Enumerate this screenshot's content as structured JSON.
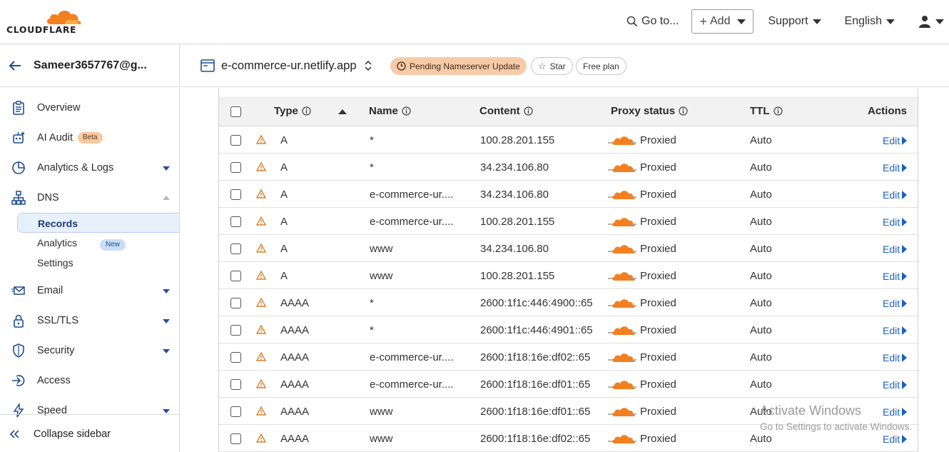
{
  "brand": {
    "logo_text": "CLOUDFLARE",
    "accent": "#f38020"
  },
  "topbar": {
    "goto_label": "Go to...",
    "add_label": "Add",
    "support_label": "Support",
    "language_label": "English"
  },
  "sidebar": {
    "account_name": "Sameer3657767@g...",
    "items": [
      {
        "label": "Overview",
        "icon": "clipboard-icon"
      },
      {
        "label": "AI Audit",
        "icon": "robot-icon",
        "badge": "Beta"
      },
      {
        "label": "Analytics & Logs",
        "icon": "pie-chart-icon"
      },
      {
        "label": "DNS",
        "icon": "network-icon"
      },
      {
        "label": "Email",
        "icon": "mail-icon"
      },
      {
        "label": "SSL/TLS",
        "icon": "lock-icon"
      },
      {
        "label": "Security",
        "icon": "shield-icon"
      },
      {
        "label": "Access",
        "icon": "access-icon"
      },
      {
        "label": "Speed",
        "icon": "bolt-icon"
      }
    ],
    "dns_sub": [
      {
        "label": "Records"
      },
      {
        "label": "Analytics",
        "badge": "New"
      },
      {
        "label": "Settings"
      }
    ],
    "collapse_label": "Collapse sidebar"
  },
  "zone": {
    "name": "e-commerce-ur.netlify.app",
    "status_pill": "Pending Nameserver Update",
    "star_label": "Star",
    "plan_label": "Free plan"
  },
  "table": {
    "headers": {
      "type": "Type",
      "name": "Name",
      "content": "Content",
      "proxy": "Proxy status",
      "ttl": "TTL",
      "actions": "Actions"
    },
    "edit_label": "Edit",
    "rows": [
      {
        "type": "A",
        "name": "*",
        "content": "100.28.201.155",
        "proxy": "Proxied",
        "ttl": "Auto"
      },
      {
        "type": "A",
        "name": "*",
        "content": "34.234.106.80",
        "proxy": "Proxied",
        "ttl": "Auto"
      },
      {
        "type": "A",
        "name": "e-commerce-ur....",
        "content": "34.234.106.80",
        "proxy": "Proxied",
        "ttl": "Auto"
      },
      {
        "type": "A",
        "name": "e-commerce-ur....",
        "content": "100.28.201.155",
        "proxy": "Proxied",
        "ttl": "Auto"
      },
      {
        "type": "A",
        "name": "www",
        "content": "34.234.106.80",
        "proxy": "Proxied",
        "ttl": "Auto"
      },
      {
        "type": "A",
        "name": "www",
        "content": "100.28.201.155",
        "proxy": "Proxied",
        "ttl": "Auto"
      },
      {
        "type": "AAAA",
        "name": "*",
        "content": "2600:1f1c:446:4900::65",
        "proxy": "Proxied",
        "ttl": "Auto"
      },
      {
        "type": "AAAA",
        "name": "*",
        "content": "2600:1f1c:446:4901::65",
        "proxy": "Proxied",
        "ttl": "Auto"
      },
      {
        "type": "AAAA",
        "name": "e-commerce-ur....",
        "content": "2600:1f18:16e:df02::65",
        "proxy": "Proxied",
        "ttl": "Auto"
      },
      {
        "type": "AAAA",
        "name": "e-commerce-ur....",
        "content": "2600:1f18:16e:df01::65",
        "proxy": "Proxied",
        "ttl": "Auto"
      },
      {
        "type": "AAAA",
        "name": "www",
        "content": "2600:1f18:16e:df01::65",
        "proxy": "Proxied",
        "ttl": "Auto"
      },
      {
        "type": "AAAA",
        "name": "www",
        "content": "2600:1f18:16e:df02::65",
        "proxy": "Proxied",
        "ttl": "Auto"
      }
    ]
  },
  "watermark": {
    "line1": "Activate Windows",
    "line2": "Go to Settings to activate Windows."
  }
}
